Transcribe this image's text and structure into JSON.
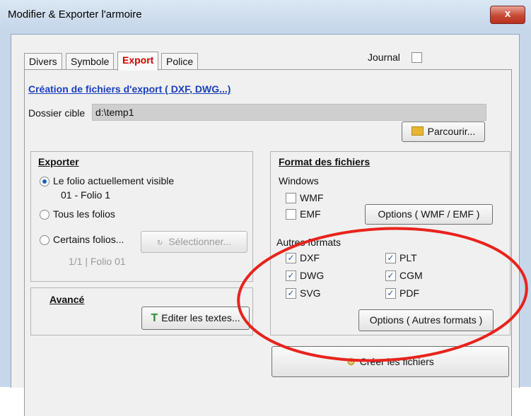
{
  "window": {
    "title": "Modifier & Exporter l'armoire",
    "close_label": "x"
  },
  "tabs": [
    {
      "label": "Divers"
    },
    {
      "label": "Symbole"
    },
    {
      "label": "Export"
    },
    {
      "label": "Police"
    }
  ],
  "journal": {
    "label": "Journal",
    "checked": false
  },
  "section_title": "Création de fichiers d'export ( DXF, DWG...)",
  "target_folder": {
    "label": "Dossier cible",
    "value": "d:\\temp1"
  },
  "browse_button": {
    "label": "Parcourir..."
  },
  "export_group": {
    "title": "Exporter",
    "options": [
      {
        "label": "Le folio actuellement visible",
        "sub": "01 - Folio 1",
        "selected": true
      },
      {
        "label": "Tous les folios",
        "selected": false
      },
      {
        "label": "Certains folios...",
        "sub": "1/1  |  Folio 01",
        "selected": false
      }
    ],
    "select_button": "Sélectionner..."
  },
  "advanced_group": {
    "title": "Avancé",
    "edit_button": "Editer les textes..."
  },
  "format_group": {
    "title": "Format des fichiers",
    "windows_label": "Windows",
    "windows_formats": [
      {
        "label": "WMF",
        "checked": false
      },
      {
        "label": "EMF",
        "checked": false
      }
    ],
    "windows_options_button": "Options ( WMF / EMF )",
    "other_label": "Autres formats",
    "other_formats": [
      {
        "label": "DXF",
        "checked": true
      },
      {
        "label": "PLT",
        "checked": true
      },
      {
        "label": "DWG",
        "checked": true
      },
      {
        "label": "CGM",
        "checked": true
      },
      {
        "label": "SVG",
        "checked": true
      },
      {
        "label": "PDF",
        "checked": true
      }
    ],
    "other_options_button": "Options ( Autres formats )"
  },
  "create_button": "Créer les fichiers",
  "colors": {
    "accent_link": "#1a3fbf",
    "active_tab": "#d20000",
    "highlight": "#e8231c"
  },
  "icons": {
    "folder": "folder-icon",
    "edit_text": "edit-text-icon",
    "create": "create-files-icon",
    "select": "select-icon"
  }
}
